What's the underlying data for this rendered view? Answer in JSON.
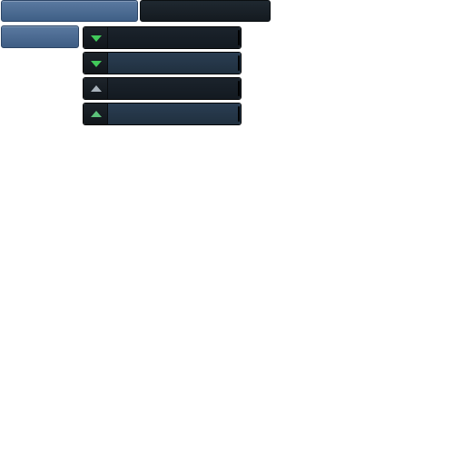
{
  "tabs": [
    {
      "label": "",
      "state": "active"
    },
    {
      "label": "",
      "state": "inactive"
    }
  ],
  "side_button": {
    "label": ""
  },
  "rows": [
    {
      "label": "",
      "arrow": "down",
      "arrow_color": "#41c95a",
      "bar_shade": "dark"
    },
    {
      "label": "",
      "arrow": "down",
      "arrow_color": "#41c95a",
      "bar_shade": "light"
    },
    {
      "label": "",
      "arrow": "up",
      "arrow_color": "#a8b2bb",
      "bar_shade": "dark"
    },
    {
      "label": "",
      "arrow": "up",
      "arrow_color": "#5cc27a",
      "bar_shade": "light"
    }
  ]
}
